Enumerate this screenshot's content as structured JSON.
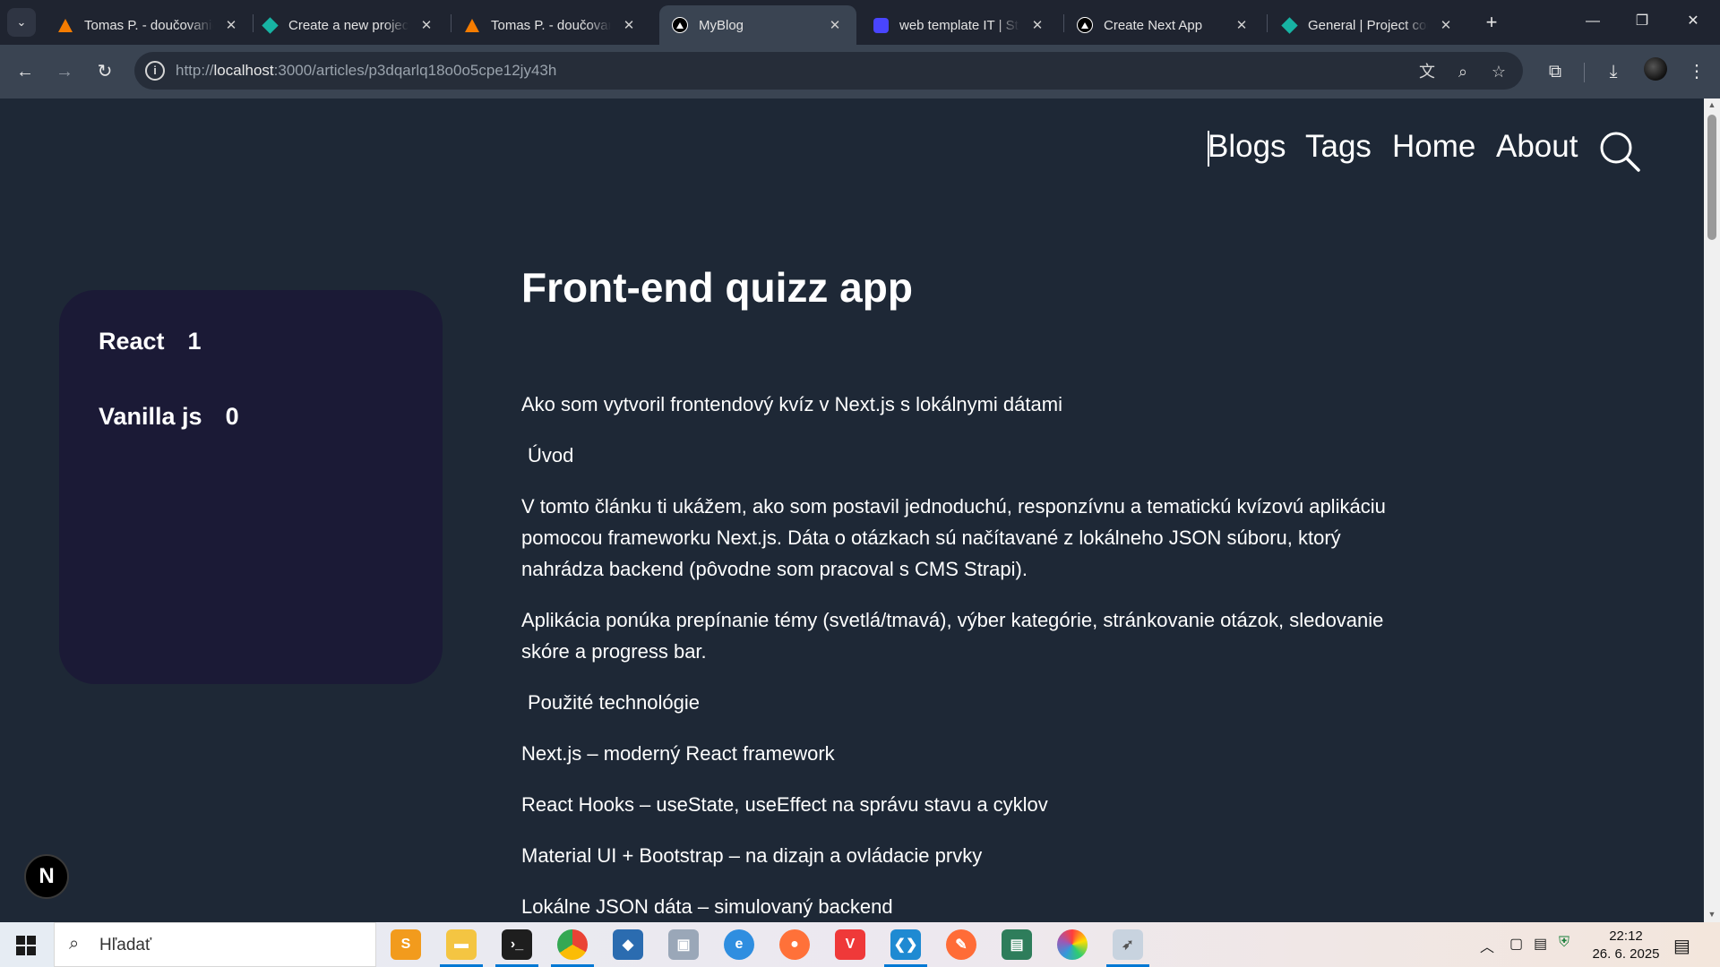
{
  "browser": {
    "tabs": [
      {
        "title": "Tomas P. - doučovanie",
        "favicon": "firebase-icon",
        "active": false
      },
      {
        "title": "Create a new project",
        "favicon": "diamond-icon",
        "active": false
      },
      {
        "title": "Tomas P. - doučovanie",
        "favicon": "firebase-icon",
        "active": false
      },
      {
        "title": "MyBlog",
        "favicon": "nextjs-icon",
        "active": true
      },
      {
        "title": "web template IT | Strapi",
        "favicon": "strapi-icon",
        "active": false
      },
      {
        "title": "Create Next App",
        "favicon": "nextjs-icon",
        "active": false
      },
      {
        "title": "General | Project con",
        "favicon": "diamond-icon",
        "active": false
      }
    ],
    "url_prefix": "http://",
    "url_host": "localhost",
    "url_path": ":3000/articles/p3dqarlq18o0o5cpe12jy43h"
  },
  "site": {
    "nav": [
      "Blogs",
      "Tags",
      "Home",
      "About"
    ],
    "tags": [
      {
        "name": "React",
        "count": "1"
      },
      {
        "name": "Vanilla js",
        "count": "0"
      }
    ],
    "article": {
      "title": "Front-end quizz app",
      "paragraphs": [
        "Ako som vytvoril frontendový kvíz v Next.js s lokálnymi dátami",
        "Úvod",
        "V tomto článku ti ukážem, ako som postavil jednoduchú, responzívnu a tematickú kvízovú aplikáciu pomocou frameworku Next.js. Dáta o otázkach sú načítavané z lokálneho JSON súboru, ktorý nahrádza backend (pôvodne som pracoval s CMS Strapi).",
        "Aplikácia ponúka prepínanie témy (svetlá/tmavá), výber kategórie, stránkovanie otázok, sledovanie skóre a progress bar.",
        "Použité technológie",
        "Next.js – moderný React framework",
        "React Hooks – useState, useEffect na správu stavu a cyklov",
        "Material UI + Bootstrap – na dizajn a ovládacie prvky",
        "Lokálne JSON dáta – simulovaný backend"
      ]
    },
    "badge": "N"
  },
  "taskbar": {
    "search_placeholder": "Hľadať",
    "time": "22:12",
    "date": "26. 6. 2025"
  },
  "colors": {
    "page_bg": "#1e2836",
    "card_bg": "#1b1a36",
    "chrome_tab": "#1f2430",
    "chrome_toolbar": "#3a4452"
  }
}
